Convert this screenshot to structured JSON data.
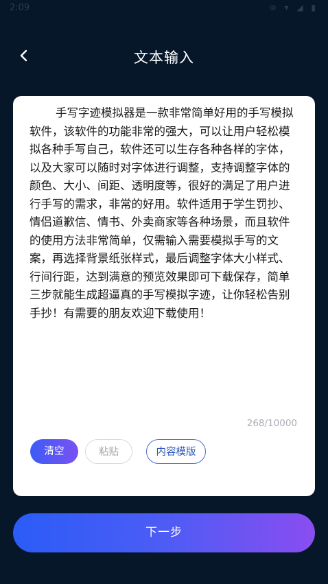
{
  "status_bar": {
    "time": "2:09",
    "icons": "⊚ ▾ ◢ ▮"
  },
  "nav": {
    "back_icon": "chevron-left-icon",
    "title": "文本输入"
  },
  "editor": {
    "content": "手写字迹模拟器是一款非常简单好用的手写模拟软件，该软件的功能非常的强大，可以让用户轻松模拟各种手写自己，软件还可以生存各种各样的字体，以及大家可以随时对字体进行调整，支持调整字体的颜色、大小、间距、透明度等，很好的满足了用户进行手写的需求，非常的好用。软件适用于学生罚抄、情侣道歉信、情书、外卖商家等各种场景，而且软件的使用方法非常简单，仅需输入需要模拟手写的文案，再选择背景纸张样式，最后调整字体大小样式、行间行距，达到满意的预览效果即可下载保存，简单三步就能生成超逼真的手写模拟字迹，让你轻松告别手抄！有需要的朋友欢迎下载使用！",
    "char_count": "268/10000"
  },
  "actions": {
    "clear_label": "清空",
    "paste_label": "粘贴",
    "template_label": "内容模版"
  },
  "footer": {
    "next_label": "下一步"
  },
  "colors": {
    "background": "#07172a",
    "card": "#ffffff",
    "accent_start": "#2b5cf7",
    "accent_end": "#8a4df0",
    "template_border": "#4a6fc8"
  }
}
